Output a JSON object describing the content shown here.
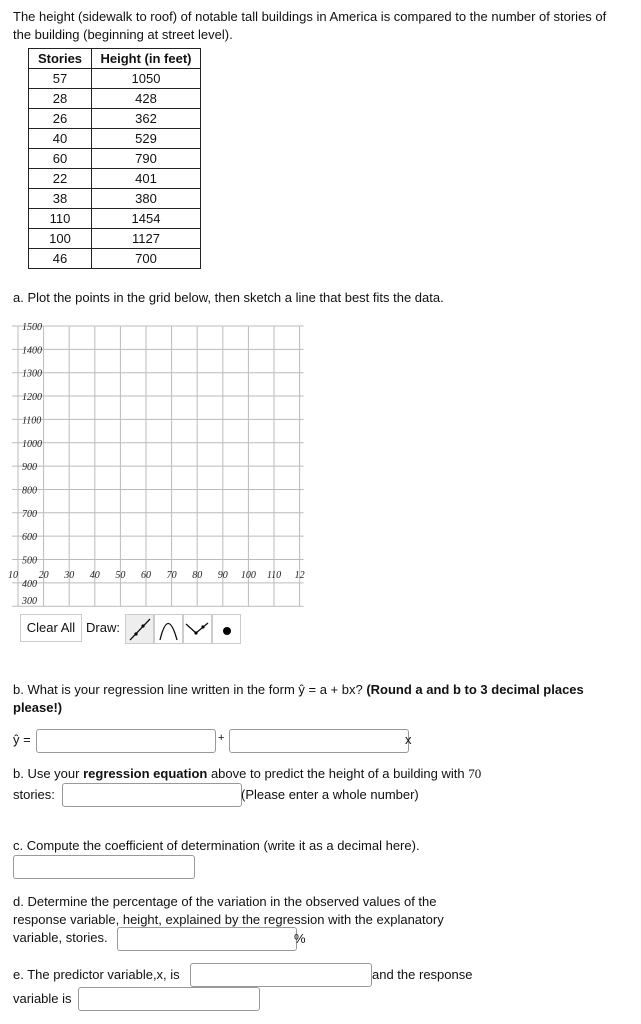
{
  "intro": "The height (sidewalk to roof) of notable tall buildings in America is compared to the number of stories of the building (beginning at street level).",
  "table": {
    "headers": [
      "Stories",
      "Height (in feet)"
    ],
    "rows": [
      [
        "57",
        "1050"
      ],
      [
        "28",
        "428"
      ],
      [
        "26",
        "362"
      ],
      [
        "40",
        "529"
      ],
      [
        "60",
        "790"
      ],
      [
        "22",
        "401"
      ],
      [
        "38",
        "380"
      ],
      [
        "110",
        "1454"
      ],
      [
        "100",
        "1127"
      ],
      [
        "46",
        "700"
      ]
    ]
  },
  "part_a": "a. Plot the points in the grid below, then sketch a line that best fits the data.",
  "grid": {
    "x_ticks": [
      "10",
      "20",
      "30",
      "40",
      "50",
      "60",
      "70",
      "80",
      "90",
      "100",
      "110",
      "12"
    ],
    "y_ticks": [
      "1500",
      "1400",
      "1300",
      "1200",
      "1100",
      "1000",
      "900",
      "800",
      "700",
      "600",
      "500",
      "400",
      "300"
    ]
  },
  "tools": {
    "clear_all": "Clear All",
    "draw": "Draw:",
    "icons": [
      "line-tool-icon",
      "parabola-tool-icon",
      "absolute-value-tool-icon",
      "point-tool-icon"
    ]
  },
  "part_b1": {
    "text": "b. What is your regression line written in the form ŷ = a + bx? ",
    "bold": "(Round a and b to 3 decimal places please!)",
    "yhat": "ŷ =",
    "plus": "+",
    "x": "x",
    "a_value": "",
    "b_value": ""
  },
  "part_b2": {
    "pre": "b. Use your ",
    "bold": "regression equation",
    "post": " above to predict the height of a building with ",
    "num": "70",
    "stories": "stories:",
    "note": "(Please enter a whole number)",
    "value": ""
  },
  "part_c": {
    "text": "c. Compute the coefficient of determination (write it as a decimal here).",
    "value": ""
  },
  "part_d": {
    "text": "d. Determine the percentage of the variation in the observed values of the response variable, height, explained by the regression with the explanatory variable, stories.",
    "pct": "%",
    "value": ""
  },
  "part_e": {
    "text1": "e. The predictor variable,x, is",
    "text2": "and the response",
    "text3": "variable is",
    "predictor": "",
    "response": ""
  }
}
